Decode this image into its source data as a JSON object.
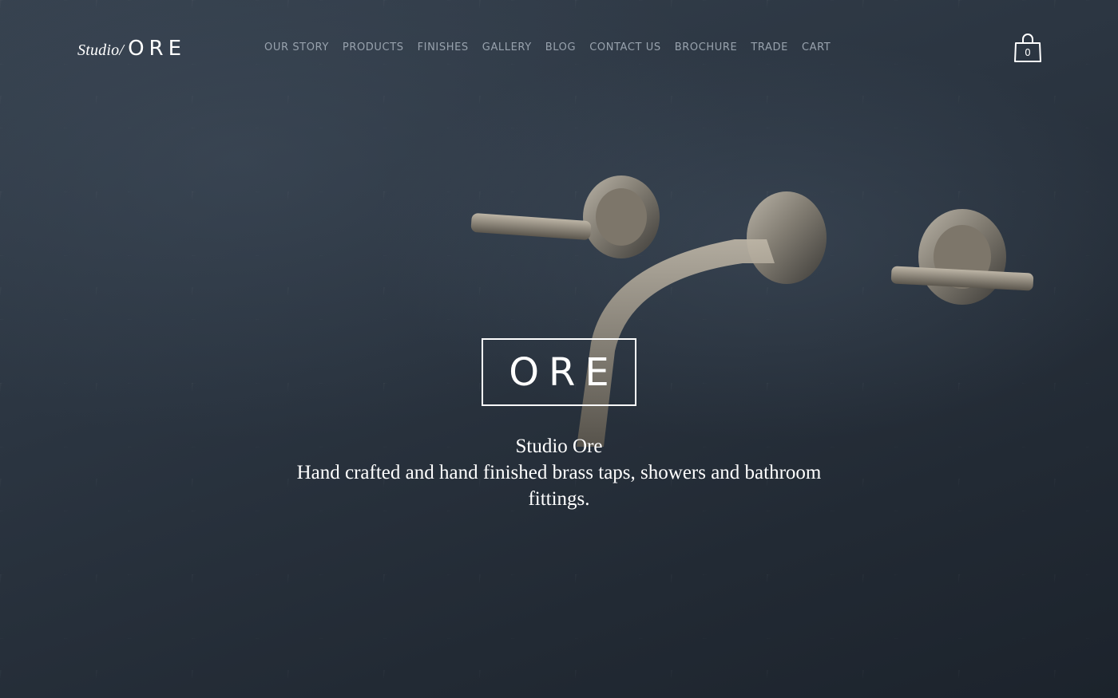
{
  "brand": {
    "script": "Studio/",
    "mark": "ORE"
  },
  "nav": {
    "items": [
      {
        "label": "OUR STORY"
      },
      {
        "label": "PRODUCTS"
      },
      {
        "label": "FINISHES"
      },
      {
        "label": "GALLERY"
      },
      {
        "label": "BLOG"
      },
      {
        "label": "CONTACT US"
      },
      {
        "label": "BROCHURE"
      },
      {
        "label": "TRADE"
      },
      {
        "label": "CART"
      }
    ]
  },
  "cart": {
    "count": "0",
    "icon": "shopping-bag-icon"
  },
  "hero": {
    "logo_text": "ORE",
    "title": "Studio Ore",
    "description": "Hand crafted and hand finished brass taps, showers and bathroom fittings."
  },
  "colors": {
    "background": "#26303b",
    "nav_text": "#98a2ad",
    "text": "#ffffff"
  }
}
